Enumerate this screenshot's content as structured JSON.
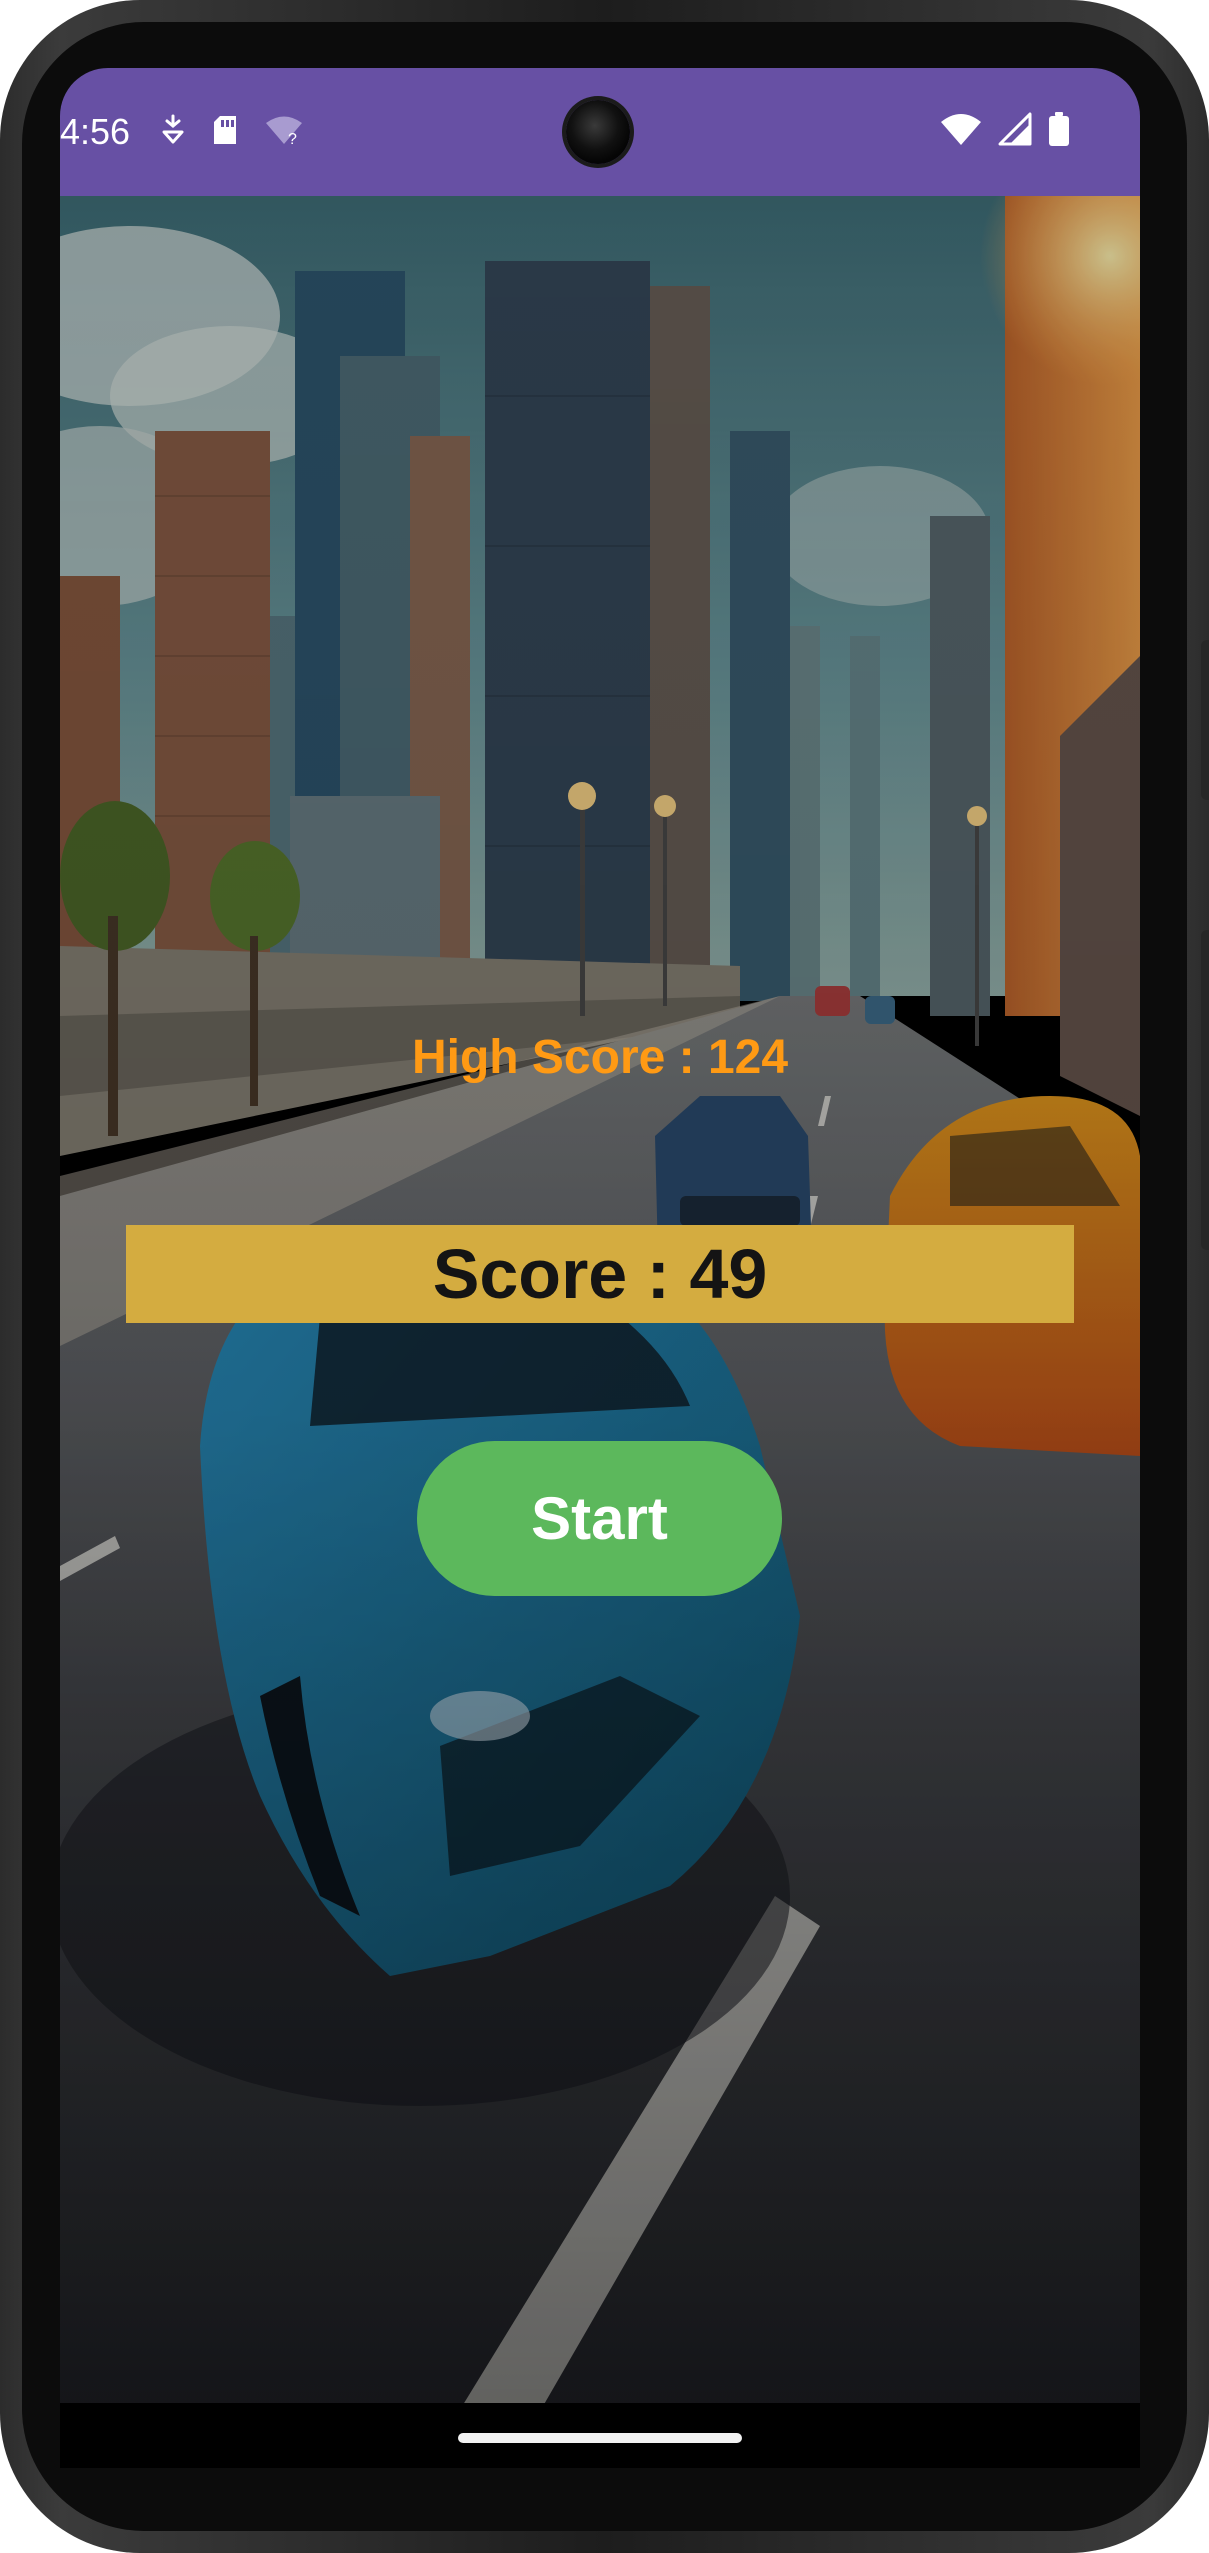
{
  "status_bar": {
    "time": "4:56",
    "background_color": "#6750a4",
    "left_icons": [
      "assistant-icon",
      "sd-card-icon",
      "wifi-unknown-icon"
    ],
    "right_icons": [
      "wifi-icon",
      "signal-icon",
      "battery-icon"
    ]
  },
  "game": {
    "high_score_text": "High Score : 124",
    "score_text": "Score : 49",
    "start_label": "Start",
    "colors": {
      "high_score": "#ff9a14",
      "score_bar": "#d4ac40",
      "start_button": "#5cb85c"
    }
  }
}
